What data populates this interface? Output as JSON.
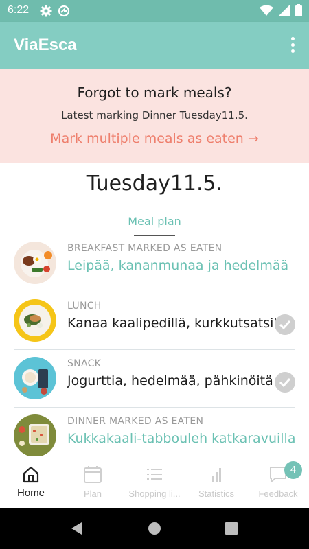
{
  "status_bar": {
    "time": "6:22"
  },
  "app_bar": {
    "title": "ViaEsca"
  },
  "banner": {
    "title": "Forgot to mark meals?",
    "latest": "Latest marking Dinner Tuesday11.5.",
    "link": "Mark multiple meals as eaten →"
  },
  "day": {
    "title": "Tuesday11.5."
  },
  "tab": {
    "label": "Meal plan"
  },
  "meals": [
    {
      "label": "BREAKFAST MARKED AS EATEN",
      "name": "Leipää, kananmunaa ja hedelmää",
      "eaten": true
    },
    {
      "label": "LUNCH",
      "name": "Kanaa kaalipedillä, kurkkutsatsikia",
      "eaten": false
    },
    {
      "label": "SNACK",
      "name": "Jogurttia, hedelmää, pähkinöitä",
      "eaten": false
    },
    {
      "label": "DINNER MARKED AS EATEN",
      "name": "Kukkakaali-tabbouleh katkaravuilla",
      "eaten": true
    }
  ],
  "bottom_nav": {
    "items": [
      {
        "label": "Home",
        "icon": "home-icon",
        "active": true
      },
      {
        "label": "Plan",
        "icon": "calendar-icon",
        "active": false
      },
      {
        "label": "Shopping li...",
        "icon": "list-icon",
        "active": false
      },
      {
        "label": "Statistics",
        "icon": "bar-chart-icon",
        "active": false
      },
      {
        "label": "Feedback",
        "icon": "chat-bubble-icon",
        "active": false
      }
    ],
    "feedback_badge": "4"
  },
  "colors": {
    "app_bar": "#84cdc2",
    "status_bar": "#6fbcad",
    "banner_bg": "#fbe3e0",
    "banner_link": "#ee7f6d",
    "accent": "#6bc1b3"
  }
}
